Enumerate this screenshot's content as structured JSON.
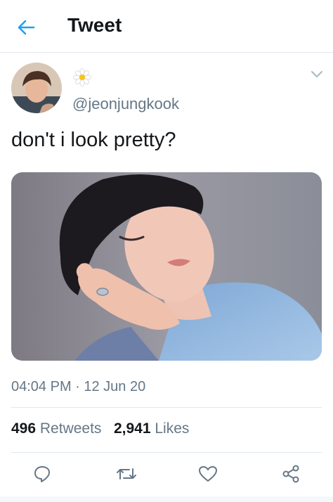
{
  "header": {
    "title": "Tweet",
    "back_icon": "arrow-left-icon"
  },
  "tweet": {
    "handle": "@jeonjungkook",
    "display_name_icon": "daisy-flower-icon",
    "text": "don't i look pretty?",
    "timestamp": "04:04 PM · 12 Jun 20",
    "retweets": "496",
    "retweets_label": "Retweets",
    "likes": "2,941",
    "likes_label": "Likes"
  },
  "actions": [
    "reply-icon",
    "retweet-icon",
    "like-icon",
    "share-icon"
  ],
  "colors": {
    "accent": "#1da1f2",
    "secondary_text": "#657786",
    "divider": "#e1e8ed",
    "icon": "#657786"
  }
}
